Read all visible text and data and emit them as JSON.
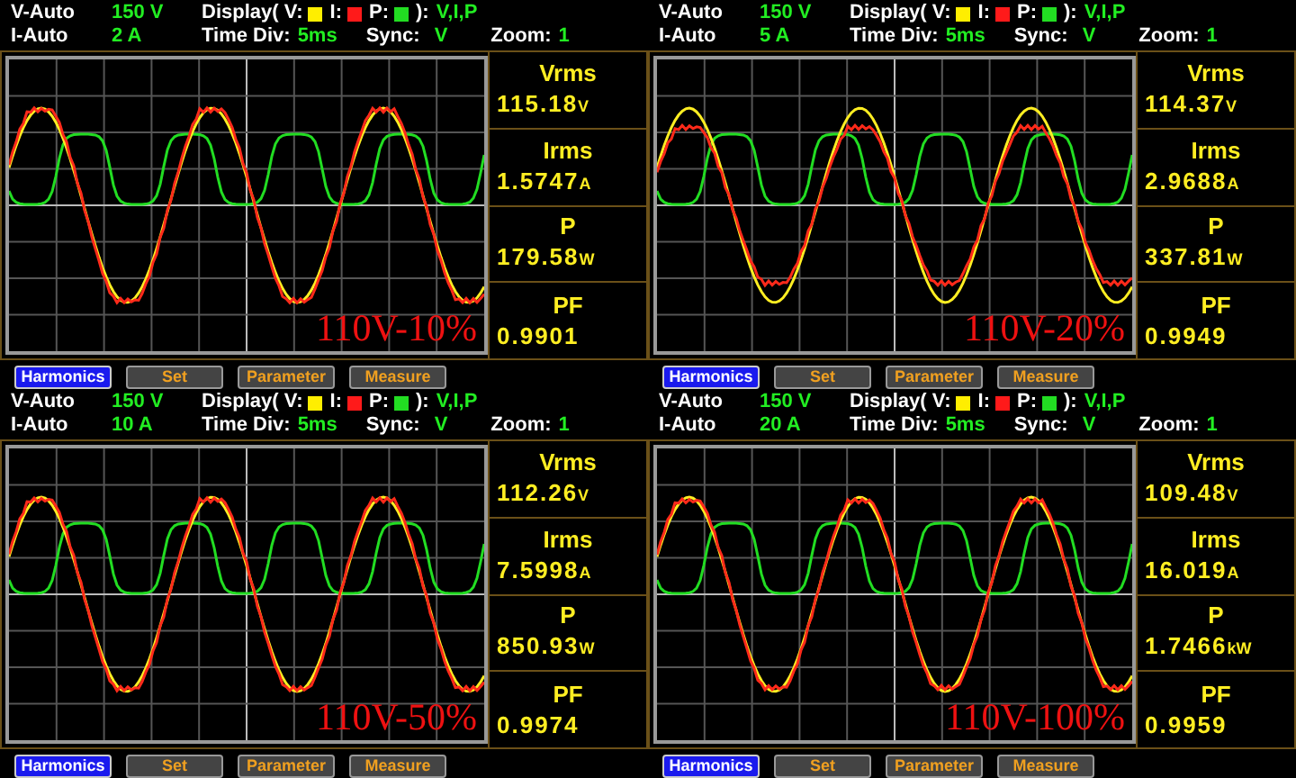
{
  "panels": [
    {
      "range_v": {
        "label": "V-Auto",
        "value": "150 V"
      },
      "range_i": {
        "label": "I-Auto",
        "value": "2 A"
      },
      "display": {
        "label": "Display(",
        "channels": [
          {
            "label": "V:",
            "color": "#ffee00"
          },
          {
            "label": "I:",
            "color": "#ff1a1a"
          },
          {
            "label": "P:",
            "color": "#22dd22"
          }
        ],
        "close": "):",
        "value": "V,I,P"
      },
      "time_div": {
        "label": "Time Div:",
        "value": "5ms"
      },
      "sync": {
        "label": "Sync:",
        "value": "V"
      },
      "zoom": {
        "label": "Zoom:",
        "value": "1"
      },
      "overlay_label": "110V-10%",
      "readings": [
        {
          "name": "Vrms",
          "value": "115.18",
          "unit": "V"
        },
        {
          "name": "Irms",
          "value": "1.5747",
          "unit": "A"
        },
        {
          "name": "P",
          "value": "179.58",
          "unit": "W"
        },
        {
          "name": "PF",
          "value": "0.9901"
        }
      ],
      "buttons": [
        {
          "label": "Harmonics",
          "selected": true
        },
        {
          "label": "Set",
          "selected": false
        },
        {
          "label": "Parameter",
          "selected": false
        },
        {
          "label": "Measure",
          "selected": false
        }
      ]
    },
    {
      "range_v": {
        "label": "V-Auto",
        "value": "150 V"
      },
      "range_i": {
        "label": "I-Auto",
        "value": "5 A"
      },
      "display": {
        "label": "Display(",
        "channels": [
          {
            "label": "V:",
            "color": "#ffee00"
          },
          {
            "label": "I:",
            "color": "#ff1a1a"
          },
          {
            "label": "P:",
            "color": "#22dd22"
          }
        ],
        "close": "):",
        "value": "V,I,P"
      },
      "time_div": {
        "label": "Time Div:",
        "value": "5ms"
      },
      "sync": {
        "label": "Sync:",
        "value": "V"
      },
      "zoom": {
        "label": "Zoom:",
        "value": "1"
      },
      "overlay_label": "110V-20%",
      "readings": [
        {
          "name": "Vrms",
          "value": "114.37",
          "unit": "V"
        },
        {
          "name": "Irms",
          "value": "2.9688",
          "unit": "A"
        },
        {
          "name": "P",
          "value": "337.81",
          "unit": "W"
        },
        {
          "name": "PF",
          "value": "0.9949"
        }
      ],
      "buttons": [
        {
          "label": "Harmonics",
          "selected": true
        },
        {
          "label": "Set",
          "selected": false
        },
        {
          "label": "Parameter",
          "selected": false
        },
        {
          "label": "Measure",
          "selected": false
        }
      ]
    },
    {
      "range_v": {
        "label": "V-Auto",
        "value": "150 V"
      },
      "range_i": {
        "label": "I-Auto",
        "value": "10 A"
      },
      "display": {
        "label": "Display(",
        "channels": [
          {
            "label": "V:",
            "color": "#ffee00"
          },
          {
            "label": "I:",
            "color": "#ff1a1a"
          },
          {
            "label": "P:",
            "color": "#22dd22"
          }
        ],
        "close": "):",
        "value": "V,I,P"
      },
      "time_div": {
        "label": "Time Div:",
        "value": "5ms"
      },
      "sync": {
        "label": "Sync:",
        "value": "V"
      },
      "zoom": {
        "label": "Zoom:",
        "value": "1"
      },
      "overlay_label": "110V-50%",
      "readings": [
        {
          "name": "Vrms",
          "value": "112.26",
          "unit": "V"
        },
        {
          "name": "Irms",
          "value": "7.5998",
          "unit": "A"
        },
        {
          "name": "P",
          "value": "850.93",
          "unit": "W"
        },
        {
          "name": "PF",
          "value": "0.9974"
        }
      ],
      "buttons": [
        {
          "label": "Harmonics",
          "selected": true
        },
        {
          "label": "Set",
          "selected": false
        },
        {
          "label": "Parameter",
          "selected": false
        },
        {
          "label": "Measure",
          "selected": false
        }
      ]
    },
    {
      "range_v": {
        "label": "V-Auto",
        "value": "150 V"
      },
      "range_i": {
        "label": "I-Auto",
        "value": "20 A"
      },
      "display": {
        "label": "Display(",
        "channels": [
          {
            "label": "V:",
            "color": "#ffee00"
          },
          {
            "label": "I:",
            "color": "#ff1a1a"
          },
          {
            "label": "P:",
            "color": "#22dd22"
          }
        ],
        "close": "):",
        "value": "V,I,P"
      },
      "time_div": {
        "label": "Time Div:",
        "value": "5ms"
      },
      "sync": {
        "label": "Sync:",
        "value": "V"
      },
      "zoom": {
        "label": "Zoom:",
        "value": "1"
      },
      "overlay_label": "110V-100%",
      "readings": [
        {
          "name": "Vrms",
          "value": "109.48",
          "unit": "V"
        },
        {
          "name": "Irms",
          "value": "16.019",
          "unit": "A"
        },
        {
          "name": "P",
          "value": "1.7466",
          "unit": "kW"
        },
        {
          "name": "PF",
          "value": "0.9959"
        }
      ],
      "buttons": [
        {
          "label": "Harmonics",
          "selected": true
        },
        {
          "label": "Set",
          "selected": false
        },
        {
          "label": "Parameter",
          "selected": false
        },
        {
          "label": "Measure",
          "selected": false
        }
      ]
    }
  ]
}
